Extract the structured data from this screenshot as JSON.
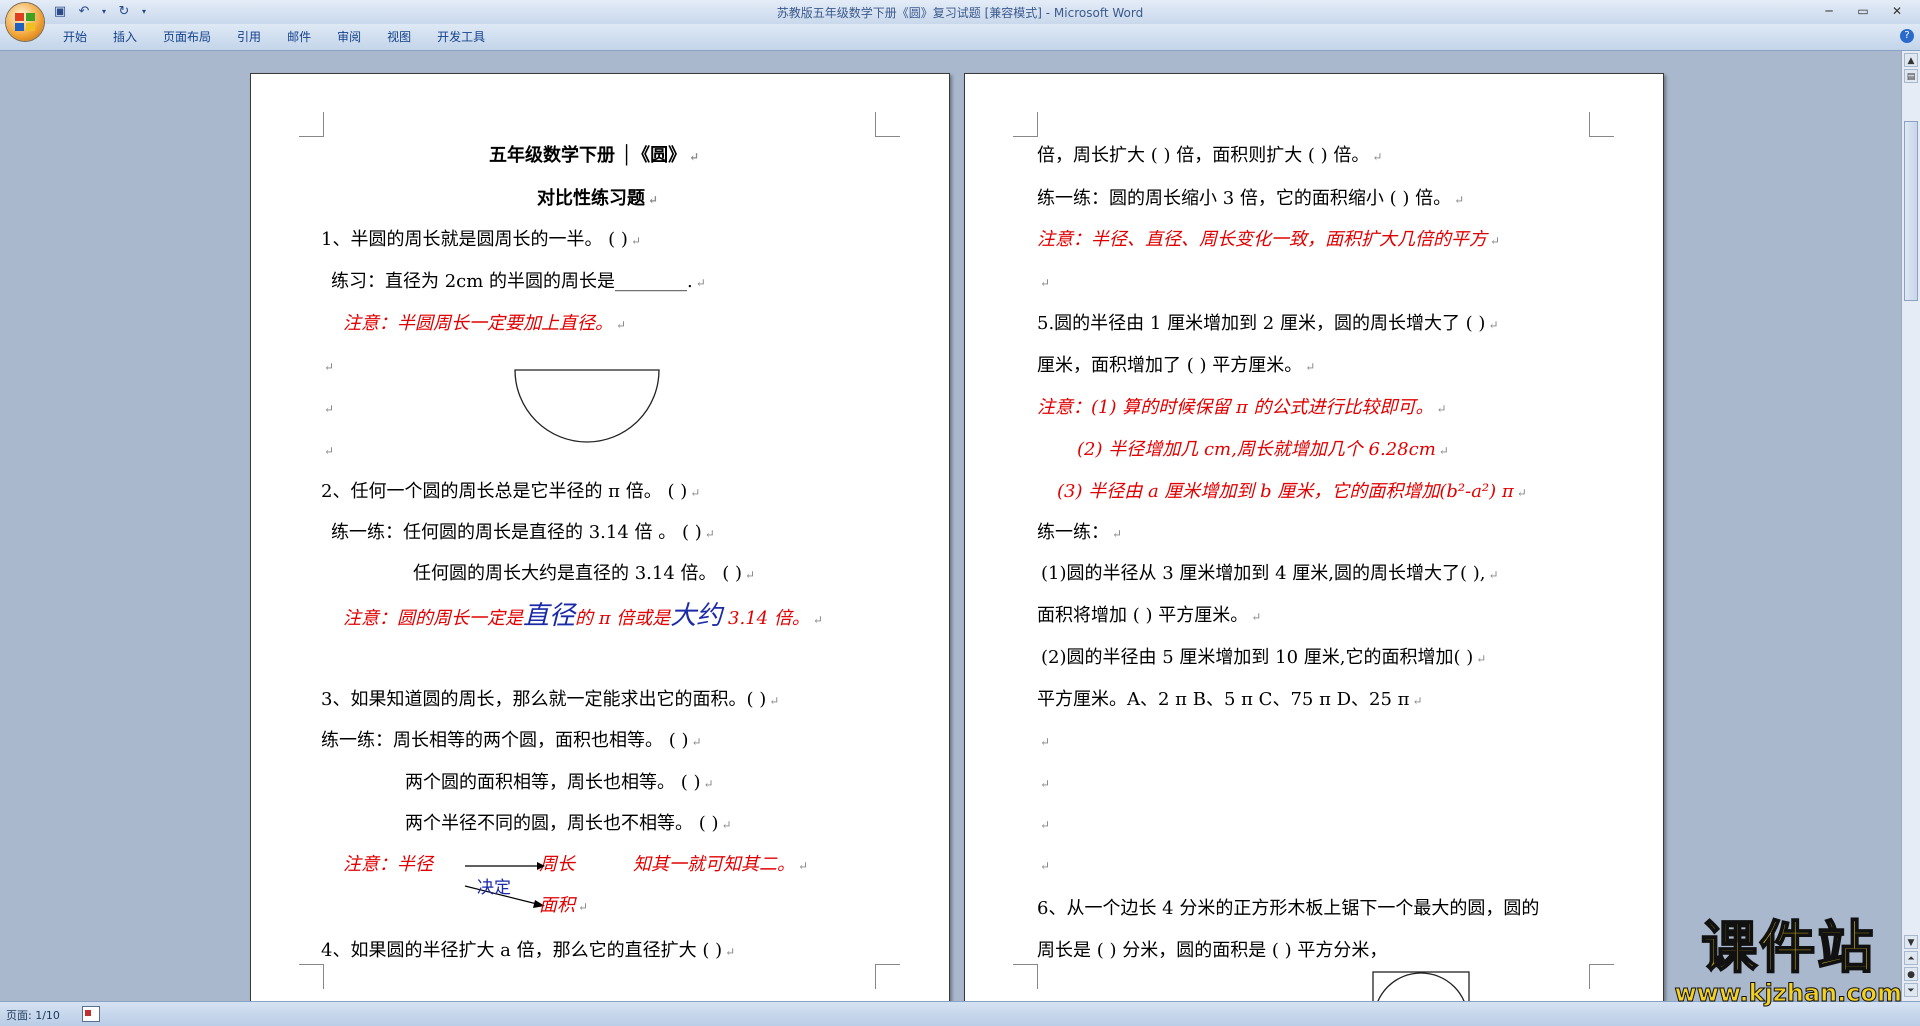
{
  "window": {
    "title": "苏教版五年级数学下册《圆》复习试题 [兼容模式] - Microsoft Word"
  },
  "ribbon": {
    "tabs": [
      "开始",
      "插入",
      "页面布局",
      "引用",
      "邮件",
      "审阅",
      "视图",
      "开发工具"
    ]
  },
  "status": {
    "page": "页面: 1/10"
  },
  "page1": {
    "title": "五年级数学下册 │《圆》",
    "subtitle": "对比性练习题",
    "q1": "1、半圆的周长就是圆周长的一半。          (      )",
    "q1_practice": "练习：直径为 2cm 的半圆的周长是________.",
    "note1": "注意：半圆周长一定要加上直径。",
    "q2": "2、任何一个圆的周长总是它半径的 π 倍。          (        )",
    "q2_p1": "练一练：任何圆的周长是直径的 3.14 倍 。          (        )",
    "q2_p2": "任何圆的周长大约是直径的 3.14 倍。     (        )",
    "note2_a": "注意：圆的周长一定是",
    "note2_b": "直径",
    "note2_c": "的 π 倍或是",
    "note2_d": "大约",
    "note2_e": " 3.14 倍。",
    "q3": "3、如果知道圆的周长，那么就一定能求出它的面积。(        )",
    "q3_p1": "练一练：周长相等的两个圆，面积也相等。          (        )",
    "q3_p2": "两个圆的面积相等，周长也相等。          (        )",
    "q3_p3": "两个半径不同的圆，周长也不相等。        (        )",
    "note3_a": "注意：半径",
    "note3_b": "周长",
    "note3_c": "知其一就可知其二。",
    "note3_d": "决定",
    "note3_e": "面积",
    "q4": "4、如果圆的半径扩大 a 倍，那么它的直径扩大 (              )"
  },
  "page2": {
    "l1": "倍，周长扩大 (          ) 倍，面积则扩大 (                ) 倍。",
    "l2": "练一练：圆的周长缩小 3 倍，它的面积缩小 (          ) 倍。",
    "note1": "注意：半径、直径、周长变化一致，面积扩大几倍的平方",
    "q5_a": "5.圆的半径由 1 厘米增加到 2 厘米，圆的周长增大了 (       )",
    "q5_b": "厘米，面积增加了 (        ) 平方厘米。",
    "note5_1": "注意：(1) 算的时候保留 π 的公式进行比较即可。",
    "note5_2": "(2) 半径增加几 cm,周长就增加几个 6.28cm",
    "note5_3": "(3) 半径由 a 厘米增加到 b 厘米，它的面积增加(b²-a²) π",
    "p5_title": "练一练：",
    "p5_1a": "(1)圆的半径从 3 厘米增加到 4 厘米,圆的周长增大了(        ),",
    "p5_1b": "面积将增加 (        ) 平方厘米。",
    "p5_2a": "(2)圆的半径由 5 厘米增加到 10 厘米,它的面积增加(          )",
    "p5_2b": "平方厘米。A、2 π       B、5 π       C、75 π       D、25 π",
    "q6_a": "6、从一个边长 4 分米的正方形木板上锯下一个最大的圆，圆的",
    "q6_b": "周长是 (          ) 分米，圆的面积是 (            ) 平方分米，"
  },
  "watermark": {
    "name": "课件站",
    "url": "www.kjzhan.com"
  }
}
